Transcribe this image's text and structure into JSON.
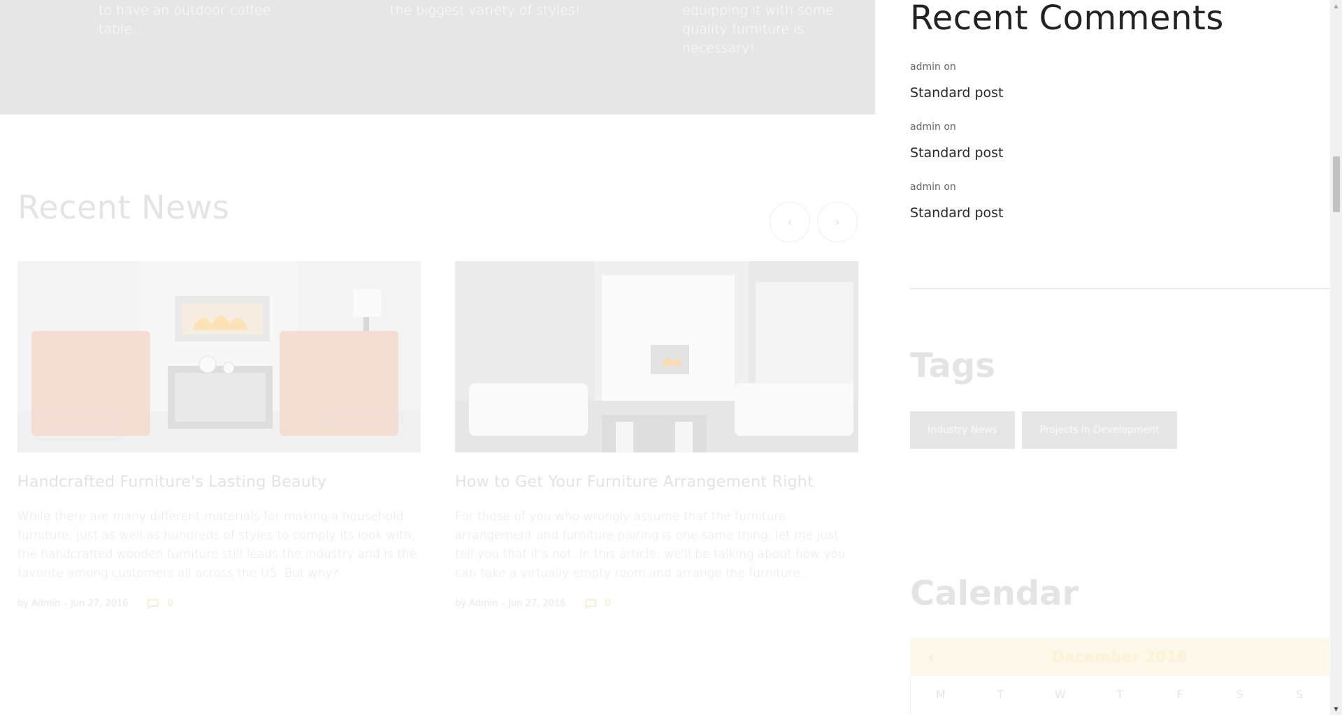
{
  "top_strip": {
    "texts": [
      "to have an outdoor coffee table...",
      "the biggest variety of styles!",
      "equipping it with some quality furniture is necessary!"
    ]
  },
  "recent_news": {
    "title": "Recent News",
    "prev_icon": "chevron-left-icon",
    "next_icon": "chevron-right-icon",
    "prev_glyph": "‹",
    "next_glyph": "›",
    "cards": [
      {
        "title": "Handcrafted Furniture's Lasting Beauty",
        "excerpt": "While there are many different materials for making a household furniture, just as well as hundreds of styles to comply its look with, the handcrafted wooden furniture still leads the industry and is the favorite among customers all across the US. But why?",
        "by": "by",
        "author": "Admin",
        "sep": "-",
        "date": "Jun 27, 2016",
        "comments": "0"
      },
      {
        "title": "How to Get Your Furniture Arrangement Right",
        "excerpt": "For those of you who wrongly assume that the furniture arrangement and furniture pairing is one same thing, let me just tell you that it's not. In this article, we'll be talking about how you can take a virtually empty room and arrange the furniture...",
        "by": "by",
        "author": "Admin",
        "sep": "-",
        "date": "Jun 27, 2016",
        "comments": "0"
      }
    ]
  },
  "recent_comments": {
    "title": "Recent Comments",
    "items": [
      {
        "author": "admin",
        "on": "on",
        "post": "Standard post"
      },
      {
        "author": "admin",
        "on": "on",
        "post": "Standard post"
      },
      {
        "author": "admin",
        "on": "on",
        "post": "Standard post"
      }
    ]
  },
  "tags": {
    "title": "Tags",
    "items": [
      "Industry News",
      "Projects in Development"
    ]
  },
  "calendar": {
    "title": "Calendar",
    "month": "December 2018",
    "prev_glyph": "‹",
    "days": [
      "M",
      "T",
      "W",
      "T",
      "F",
      "S",
      "S"
    ]
  },
  "colors": {
    "strip_bg": "#e6e6e6",
    "tag_bg": "#e6e6e6",
    "calendar_header_bg": "#fdf8ea",
    "accent": "#f4e6c3"
  }
}
